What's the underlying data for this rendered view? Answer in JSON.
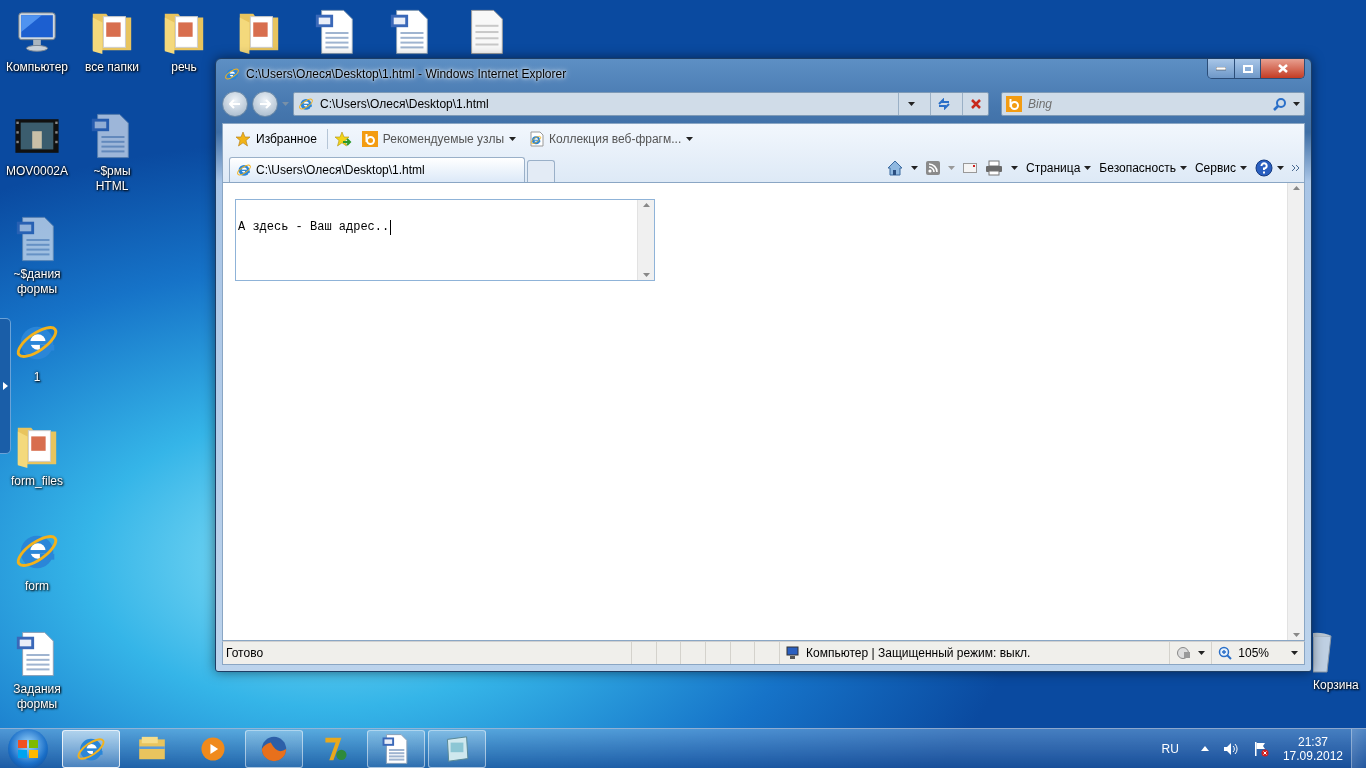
{
  "desktop": {
    "icons": [
      {
        "kind": "computer",
        "label": "Компьютер"
      },
      {
        "kind": "folder",
        "label": "все папки"
      },
      {
        "kind": "folder",
        "label": "речь"
      },
      {
        "kind": "folder"
      },
      {
        "kind": "word"
      },
      {
        "kind": "word"
      },
      {
        "kind": "text"
      },
      {
        "kind": "video",
        "label": "MOV0002A"
      },
      {
        "kind": "word-temp",
        "label": "~$рмы HTML"
      },
      {
        "kind": "word-temp",
        "label": "~$дания формы"
      },
      {
        "kind": "ie",
        "label": "1"
      },
      {
        "kind": "folder",
        "label": "form_files"
      },
      {
        "kind": "ie",
        "label": "form"
      },
      {
        "kind": "word",
        "label": "Задания формы"
      },
      {
        "kind": "recycle",
        "label": "Корзина"
      }
    ]
  },
  "window": {
    "title": "C:\\Users\\Олеся\\Desktop\\1.html - Windows Internet Explorer",
    "address": "C:\\Users\\Олеся\\Desktop\\1.html",
    "search": {
      "placeholder": "Bing"
    },
    "favorites_bar": {
      "favorites": "Избранное",
      "links": [
        {
          "label": "Рекомендуемые узлы",
          "kind": "bing"
        },
        {
          "label": "Коллекция веб-фрагм...",
          "kind": "page"
        }
      ]
    },
    "tabs": [
      {
        "label": "C:\\Users\\Олеся\\Desktop\\1.html",
        "selected": true
      }
    ],
    "command_bar": [
      {
        "label": "Страница"
      },
      {
        "label": "Безопасность"
      },
      {
        "label": "Сервис"
      }
    ],
    "page": {
      "textarea": {
        "value": "А здесь - Ваш адрес.."
      }
    },
    "status_bar": {
      "status": "Готово",
      "zone": "Компьютер | Защищенный режим: выкл.",
      "zoom": "105%"
    }
  },
  "taskbar": {
    "buttons": [
      {
        "kind": "ie",
        "active": true,
        "running": true
      },
      {
        "kind": "explorer",
        "active": false,
        "running": false
      },
      {
        "kind": "media",
        "active": false,
        "running": false
      },
      {
        "kind": "firefox",
        "active": false,
        "running": true
      },
      {
        "kind": "sevenzip",
        "active": false,
        "running": false
      },
      {
        "kind": "word",
        "active": false,
        "running": true
      },
      {
        "kind": "notepad",
        "active": false,
        "running": true
      }
    ],
    "tray": {
      "language": "RU",
      "time": "21:37",
      "date": "17.09.2012"
    }
  }
}
